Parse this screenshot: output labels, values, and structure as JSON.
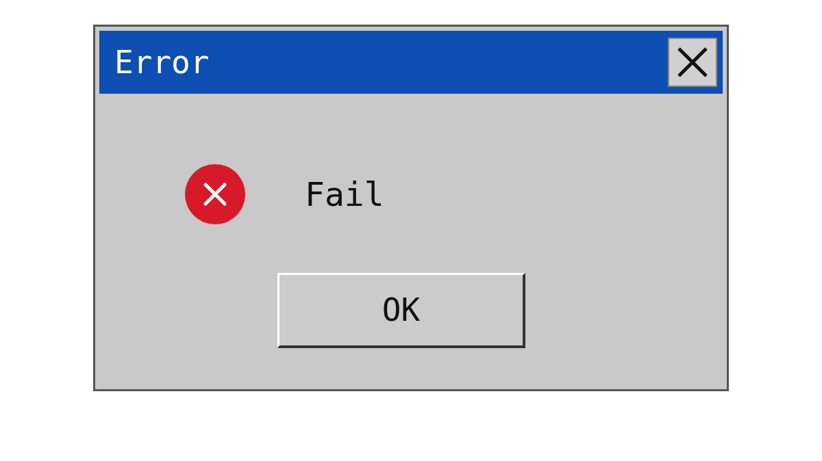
{
  "window": {
    "title": "Error"
  },
  "message": {
    "kind": "error",
    "text": "Fail"
  },
  "buttons": [
    {
      "label": "OK"
    }
  ]
}
